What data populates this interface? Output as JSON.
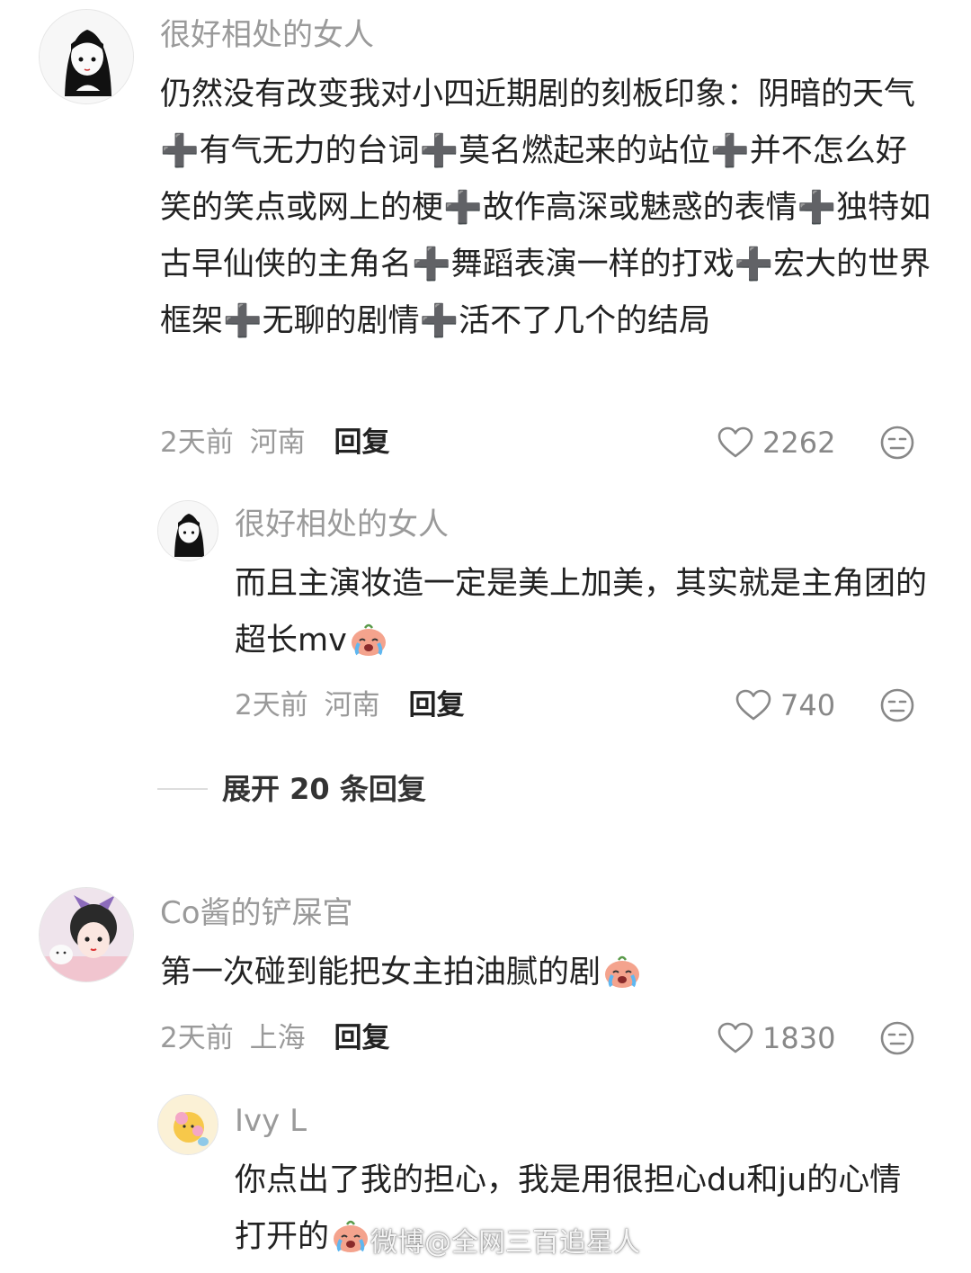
{
  "comments": [
    {
      "username": "很好相处的女人",
      "text": "仍然没有改变我对小四近期剧的刻板印象：阴暗的天气➕有气无力的台词➕莫名燃起来的站位➕并不怎么好笑的笑点或网上的梗➕故作高深或魅惑的表情➕独特如古早仙侠的主角名➕舞蹈表演一样的打戏➕宏大的世界框架➕无聊的剧情➕活不了几个的结局",
      "time": "2天前",
      "location": "河南",
      "reply_label": "回复",
      "likes": "2262",
      "replies": [
        {
          "username": "很好相处的女人",
          "text": "而且主演妆造一定是美上加美，其实就是主角团的超长mv",
          "emoji": "crying-emoji",
          "time": "2天前",
          "location": "河南",
          "reply_label": "回复",
          "likes": "740"
        }
      ],
      "expand_label": "展开 20 条回复"
    },
    {
      "username": "Co酱的铲屎官",
      "text": "第一次碰到能把女主拍油腻的剧",
      "emoji": "crying-emoji",
      "time": "2天前",
      "location": "上海",
      "reply_label": "回复",
      "likes": "1830",
      "replies": [
        {
          "username": "Ivy L",
          "text": "你点出了我的担心，我是用很担心du和ju的心情打开的",
          "emoji": "crying-emoji"
        }
      ]
    }
  ],
  "watermark": "微博@全网三百追星人",
  "colors": {
    "text": "#222222",
    "meta": "#9a9a9a",
    "icon": "#888888",
    "emoji": "#f4a38d"
  }
}
